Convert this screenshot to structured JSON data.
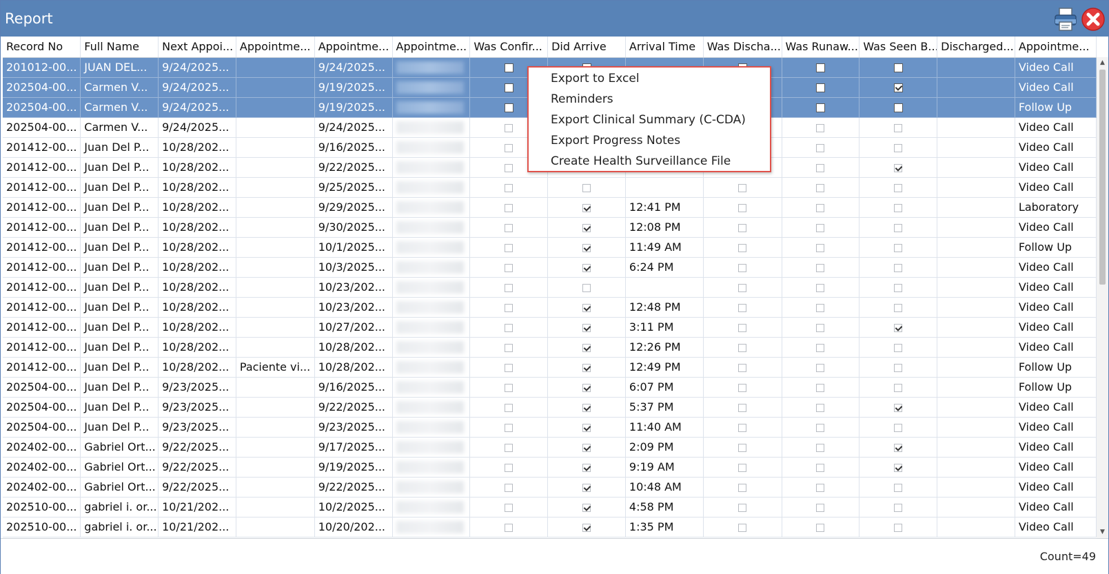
{
  "window": {
    "title": "Report"
  },
  "icons": {
    "print": "printer-icon",
    "close": "close-icon"
  },
  "colors": {
    "titlebar": "#5883b7",
    "selected_row": "#6a93c7",
    "menu_border": "#e0524b",
    "close": "#e33b3b"
  },
  "columns": [
    "Record No",
    "Full Name",
    "Next Appoi...",
    "Appointme...",
    "Appointme...",
    "Appointme...",
    "Was Confir...",
    "Did Arrive",
    "Arrival Time",
    "Was Discha...",
    "Was Runaw...",
    "Was Seen B...",
    "Discharged...",
    "Appointme..."
  ],
  "rows": [
    {
      "record": "201012-00...",
      "name": "JUAN DEL...",
      "next": "9/24/2025...",
      "note": "",
      "appt": "9/24/2025...",
      "confirmed": false,
      "arrived": false,
      "time": "",
      "discharged": false,
      "runaway": false,
      "seen": false,
      "dischargedTo": "",
      "type": "Video Call",
      "selected": true
    },
    {
      "record": "202504-00...",
      "name": "Carmen V...",
      "next": "9/24/2025...",
      "note": "",
      "appt": "9/19/2025...",
      "confirmed": false,
      "arrived": false,
      "time": "",
      "discharged": false,
      "runaway": false,
      "seen": true,
      "dischargedTo": "",
      "type": "Video Call",
      "selected": true
    },
    {
      "record": "202504-00...",
      "name": "Carmen V...",
      "next": "9/24/2025...",
      "note": "",
      "appt": "9/19/2025...",
      "confirmed": false,
      "arrived": false,
      "time": "",
      "discharged": false,
      "runaway": false,
      "seen": false,
      "dischargedTo": "",
      "type": "Follow Up",
      "selected": true
    },
    {
      "record": "202504-00...",
      "name": "Carmen V...",
      "next": "9/24/2025...",
      "note": "",
      "appt": "9/24/2025...",
      "confirmed": false,
      "arrived": false,
      "time": "",
      "discharged": false,
      "runaway": false,
      "seen": false,
      "dischargedTo": "",
      "type": "Video Call",
      "selected": false
    },
    {
      "record": "201412-00...",
      "name": "Juan Del P...",
      "next": "10/28/202...",
      "note": "",
      "appt": "9/16/2025...",
      "confirmed": false,
      "arrived": false,
      "time": "",
      "discharged": false,
      "runaway": false,
      "seen": false,
      "dischargedTo": "",
      "type": "Video Call",
      "selected": false
    },
    {
      "record": "201412-00...",
      "name": "Juan Del P...",
      "next": "10/28/202...",
      "note": "",
      "appt": "9/22/2025...",
      "confirmed": false,
      "arrived": false,
      "time": "",
      "discharged": false,
      "runaway": false,
      "seen": true,
      "dischargedTo": "",
      "type": "Video Call",
      "selected": false
    },
    {
      "record": "201412-00...",
      "name": "Juan Del P...",
      "next": "10/28/202...",
      "note": "",
      "appt": "9/25/2025...",
      "confirmed": false,
      "arrived": false,
      "time": "",
      "discharged": false,
      "runaway": false,
      "seen": false,
      "dischargedTo": "",
      "type": "Video Call",
      "selected": false
    },
    {
      "record": "201412-00...",
      "name": "Juan Del P...",
      "next": "10/28/202...",
      "note": "",
      "appt": "9/29/2025...",
      "confirmed": false,
      "arrived": true,
      "time": "12:41 PM",
      "discharged": false,
      "runaway": false,
      "seen": false,
      "dischargedTo": "",
      "type": "Laboratory",
      "selected": false
    },
    {
      "record": "201412-00...",
      "name": "Juan Del P...",
      "next": "10/28/202...",
      "note": "",
      "appt": "9/30/2025...",
      "confirmed": false,
      "arrived": true,
      "time": "12:08 PM",
      "discharged": false,
      "runaway": false,
      "seen": false,
      "dischargedTo": "",
      "type": "Video Call",
      "selected": false
    },
    {
      "record": "201412-00...",
      "name": "Juan Del P...",
      "next": "10/28/202...",
      "note": "",
      "appt": "10/1/2025...",
      "confirmed": false,
      "arrived": true,
      "time": "11:49 AM",
      "discharged": false,
      "runaway": false,
      "seen": false,
      "dischargedTo": "",
      "type": "Follow Up",
      "selected": false
    },
    {
      "record": "201412-00...",
      "name": "Juan Del P...",
      "next": "10/28/202...",
      "note": "",
      "appt": "10/3/2025...",
      "confirmed": false,
      "arrived": true,
      "time": "6:24 PM",
      "discharged": false,
      "runaway": false,
      "seen": false,
      "dischargedTo": "",
      "type": "Video Call",
      "selected": false
    },
    {
      "record": "201412-00...",
      "name": "Juan Del P...",
      "next": "10/28/202...",
      "note": "",
      "appt": "10/23/202...",
      "confirmed": false,
      "arrived": false,
      "time": "",
      "discharged": false,
      "runaway": false,
      "seen": false,
      "dischargedTo": "",
      "type": "Video Call",
      "selected": false
    },
    {
      "record": "201412-00...",
      "name": "Juan Del P...",
      "next": "10/28/202...",
      "note": "",
      "appt": "10/23/202...",
      "confirmed": false,
      "arrived": true,
      "time": "12:48 PM",
      "discharged": false,
      "runaway": false,
      "seen": false,
      "dischargedTo": "",
      "type": "Video Call",
      "selected": false
    },
    {
      "record": "201412-00...",
      "name": "Juan Del P...",
      "next": "10/28/202...",
      "note": "",
      "appt": "10/27/202...",
      "confirmed": false,
      "arrived": true,
      "time": "3:11 PM",
      "discharged": false,
      "runaway": false,
      "seen": true,
      "dischargedTo": "",
      "type": "Video Call",
      "selected": false
    },
    {
      "record": "201412-00...",
      "name": "Juan Del P...",
      "next": "10/28/202...",
      "note": "",
      "appt": "10/28/202...",
      "confirmed": false,
      "arrived": true,
      "time": "12:26 PM",
      "discharged": false,
      "runaway": false,
      "seen": false,
      "dischargedTo": "",
      "type": "Video Call",
      "selected": false
    },
    {
      "record": "201412-00...",
      "name": "Juan Del P...",
      "next": "10/28/202...",
      "note": "Paciente vi...",
      "appt": "10/28/202...",
      "confirmed": false,
      "arrived": true,
      "time": "12:49 PM",
      "discharged": false,
      "runaway": false,
      "seen": false,
      "dischargedTo": "",
      "type": "Follow Up",
      "selected": false
    },
    {
      "record": "202504-00...",
      "name": "Juan Del P...",
      "next": "9/23/2025...",
      "note": "",
      "appt": "9/16/2025...",
      "confirmed": false,
      "arrived": true,
      "time": "6:07 PM",
      "discharged": false,
      "runaway": false,
      "seen": false,
      "dischargedTo": "",
      "type": "Follow Up",
      "selected": false
    },
    {
      "record": "202504-00...",
      "name": "Juan Del P...",
      "next": "9/23/2025...",
      "note": "",
      "appt": "9/22/2025...",
      "confirmed": false,
      "arrived": true,
      "time": "5:37 PM",
      "discharged": false,
      "runaway": false,
      "seen": true,
      "dischargedTo": "",
      "type": "Video Call",
      "selected": false
    },
    {
      "record": "202504-00...",
      "name": "Juan Del P...",
      "next": "9/23/2025...",
      "note": "",
      "appt": "9/23/2025...",
      "confirmed": false,
      "arrived": true,
      "time": "11:40 AM",
      "discharged": false,
      "runaway": false,
      "seen": false,
      "dischargedTo": "",
      "type": "Video Call",
      "selected": false
    },
    {
      "record": "202402-00...",
      "name": "Gabriel Ort...",
      "next": "9/22/2025...",
      "note": "",
      "appt": "9/17/2025...",
      "confirmed": false,
      "arrived": true,
      "time": "2:09 PM",
      "discharged": false,
      "runaway": false,
      "seen": true,
      "dischargedTo": "",
      "type": "Video Call",
      "selected": false
    },
    {
      "record": "202402-00...",
      "name": "Gabriel Ort...",
      "next": "9/22/2025...",
      "note": "",
      "appt": "9/19/2025...",
      "confirmed": false,
      "arrived": true,
      "time": "9:19 AM",
      "discharged": false,
      "runaway": false,
      "seen": true,
      "dischargedTo": "",
      "type": "Video Call",
      "selected": false
    },
    {
      "record": "202402-00...",
      "name": "Gabriel Ort...",
      "next": "9/22/2025...",
      "note": "",
      "appt": "9/22/2025...",
      "confirmed": false,
      "arrived": true,
      "time": "10:48 AM",
      "discharged": false,
      "runaway": false,
      "seen": false,
      "dischargedTo": "",
      "type": "Video Call",
      "selected": false
    },
    {
      "record": "202510-00...",
      "name": "gabriel i. or...",
      "next": "10/21/202...",
      "note": "",
      "appt": "10/2/2025...",
      "confirmed": false,
      "arrived": true,
      "time": "4:58 PM",
      "discharged": false,
      "runaway": false,
      "seen": false,
      "dischargedTo": "",
      "type": "Video Call",
      "selected": false
    },
    {
      "record": "202510-00...",
      "name": "gabriel i. or...",
      "next": "10/21/202...",
      "note": "",
      "appt": "10/20/202...",
      "confirmed": false,
      "arrived": true,
      "time": "1:35 PM",
      "discharged": false,
      "runaway": false,
      "seen": false,
      "dischargedTo": "",
      "type": "Video Call",
      "selected": false
    }
  ],
  "context_menu": {
    "items": [
      "Export to Excel",
      "Reminders",
      "Export Clinical Summary (C-CDA)",
      "Export Progress Notes",
      "Create Health Surveillance File"
    ]
  },
  "footer": {
    "count": "Count=49"
  }
}
